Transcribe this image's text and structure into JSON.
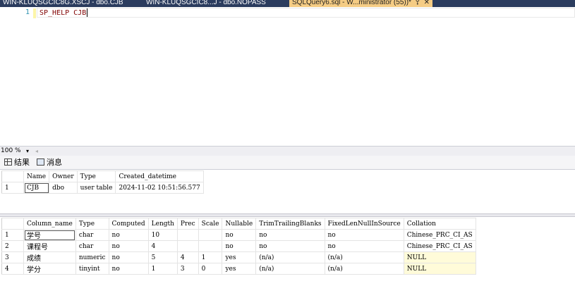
{
  "tabs": [
    {
      "label": "WIN-KLUQSGCIC8G.XSCJ - dbo.CJB",
      "active": false
    },
    {
      "label": "WIN-KLUQSGCIC8...J - dbo.NOPASS",
      "active": false
    },
    {
      "label": "SQLQuery6.sql - W...ministrator (55))*",
      "active": true
    }
  ],
  "editor": {
    "line_number": "1",
    "code": "SP_HELP CJB"
  },
  "zoom": "100 %",
  "result_tabs": {
    "results": "结果",
    "messages": "消息"
  },
  "table1": {
    "headers": [
      "Name",
      "Owner",
      "Type",
      "Created_datetime"
    ],
    "rows": [
      {
        "n": "1",
        "cells": [
          "CJB",
          "dbo",
          "user table",
          "2024-11-02 10:51:56.577"
        ]
      }
    ]
  },
  "table2": {
    "headers": [
      "Column_name",
      "Type",
      "Computed",
      "Length",
      "Prec",
      "Scale",
      "Nullable",
      "TrimTrailingBlanks",
      "FixedLenNullInSource",
      "Collation"
    ],
    "rows": [
      {
        "n": "1",
        "cells": [
          "学号",
          "char",
          "no",
          "10",
          "",
          "",
          "no",
          "no",
          "no",
          "Chinese_PRC_CI_AS"
        ]
      },
      {
        "n": "2",
        "cells": [
          "课程号",
          "char",
          "no",
          "4",
          "",
          "",
          "no",
          "no",
          "no",
          "Chinese_PRC_CI_AS"
        ]
      },
      {
        "n": "3",
        "cells": [
          "成绩",
          "numeric",
          "no",
          "5",
          "4",
          "1",
          "yes",
          "(n/a)",
          "(n/a)",
          "NULL"
        ]
      },
      {
        "n": "4",
        "cells": [
          "学分",
          "tinyint",
          "no",
          "1",
          "3",
          "0",
          "yes",
          "(n/a)",
          "(n/a)",
          "NULL"
        ]
      }
    ]
  },
  "icons": {
    "pin": "pin-icon",
    "close": "close-icon",
    "grid": "grid-icon",
    "messages": "messages-icon"
  }
}
